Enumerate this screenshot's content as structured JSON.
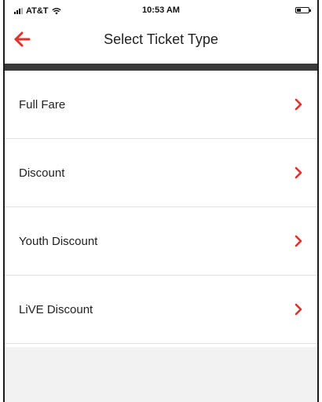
{
  "status_bar": {
    "carrier": "AT&T",
    "time": "10:53 AM",
    "battery_level": 0.35
  },
  "nav": {
    "title": "Select Ticket Type",
    "back_icon": "arrow-left-icon"
  },
  "ticket_types": [
    {
      "label": "Full Fare"
    },
    {
      "label": "Discount"
    },
    {
      "label": "Youth Discount"
    },
    {
      "label": "LiVE Discount"
    }
  ],
  "colors": {
    "accent": "#e0322d",
    "divider_bar": "#3a3a3a",
    "footer_background": "#f2f2f2"
  }
}
